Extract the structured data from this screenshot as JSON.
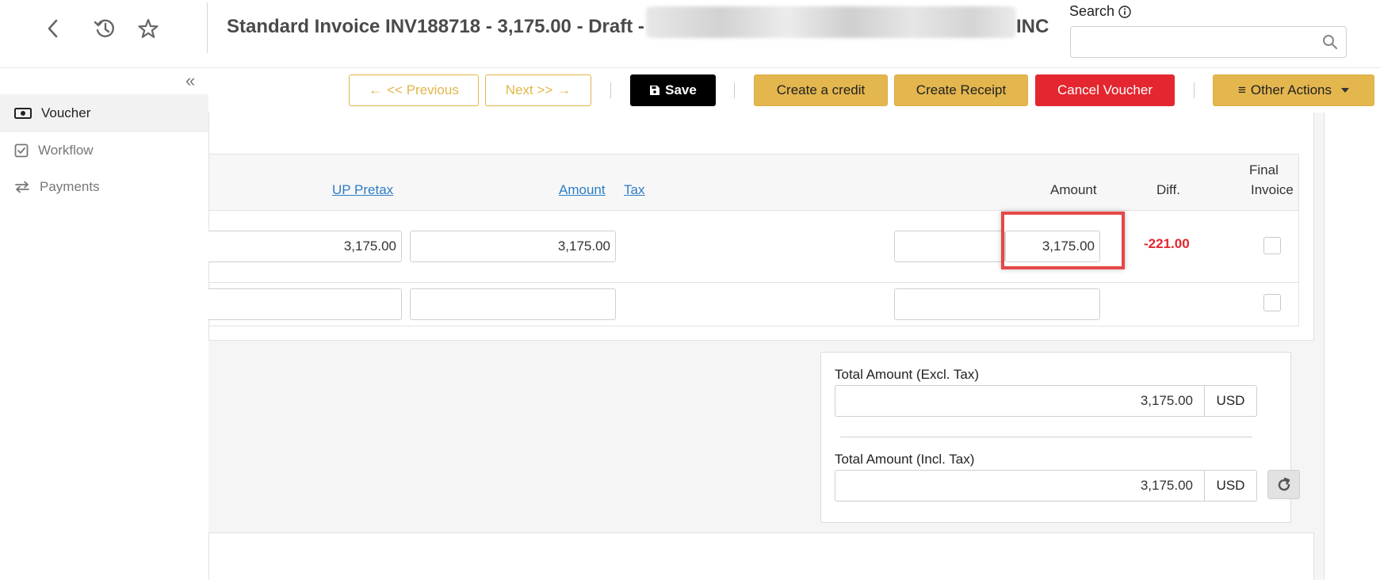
{
  "header": {
    "title": "Standard Invoice INV188718 - 3,175.00 - Draft -",
    "title_suffix": "INC",
    "search_label": "Search",
    "search_value": ""
  },
  "sidebar": {
    "items": [
      {
        "label": "Voucher",
        "icon": "voucher-icon",
        "active": true
      },
      {
        "label": "Workflow",
        "icon": "checkbox-icon",
        "active": false
      },
      {
        "label": "Payments",
        "icon": "transfer-icon",
        "active": false
      }
    ]
  },
  "toolbar": {
    "previous_label": "<< Previous",
    "next_label": "Next >>",
    "save_label": "Save",
    "create_credit_label": "Create a credit",
    "create_receipt_label": "Create Receipt",
    "cancel_voucher_label": "Cancel Voucher",
    "other_actions_label": "Other Actions"
  },
  "table": {
    "headers": {
      "up_pretax": "UP Pretax",
      "amount": "Amount",
      "tax": "Tax",
      "amount2": "Amount",
      "diff": "Diff.",
      "final_invoice_line1": "Final",
      "final_invoice_line2": "Invoice"
    },
    "rows": [
      {
        "up_pretax": "3,175.00",
        "amount": "3,175.00",
        "field_a": "",
        "amount2": "3,175.00",
        "diff": "-221.00",
        "final_invoice": false
      },
      {
        "up_pretax": "",
        "amount": "",
        "field_a": "",
        "amount2": "",
        "diff": "",
        "final_invoice": false
      }
    ]
  },
  "totals": {
    "excl_label": "Total Amount (Excl. Tax)",
    "excl_value": "3,175.00",
    "excl_currency": "USD",
    "incl_label": "Total Amount (Incl. Tax)",
    "incl_value": "3,175.00",
    "incl_currency": "USD"
  },
  "colors": {
    "accent_gold": "#e4b64e",
    "danger_red": "#e3262f",
    "link_blue": "#2d7dc4",
    "highlight_red": "#e54848"
  }
}
